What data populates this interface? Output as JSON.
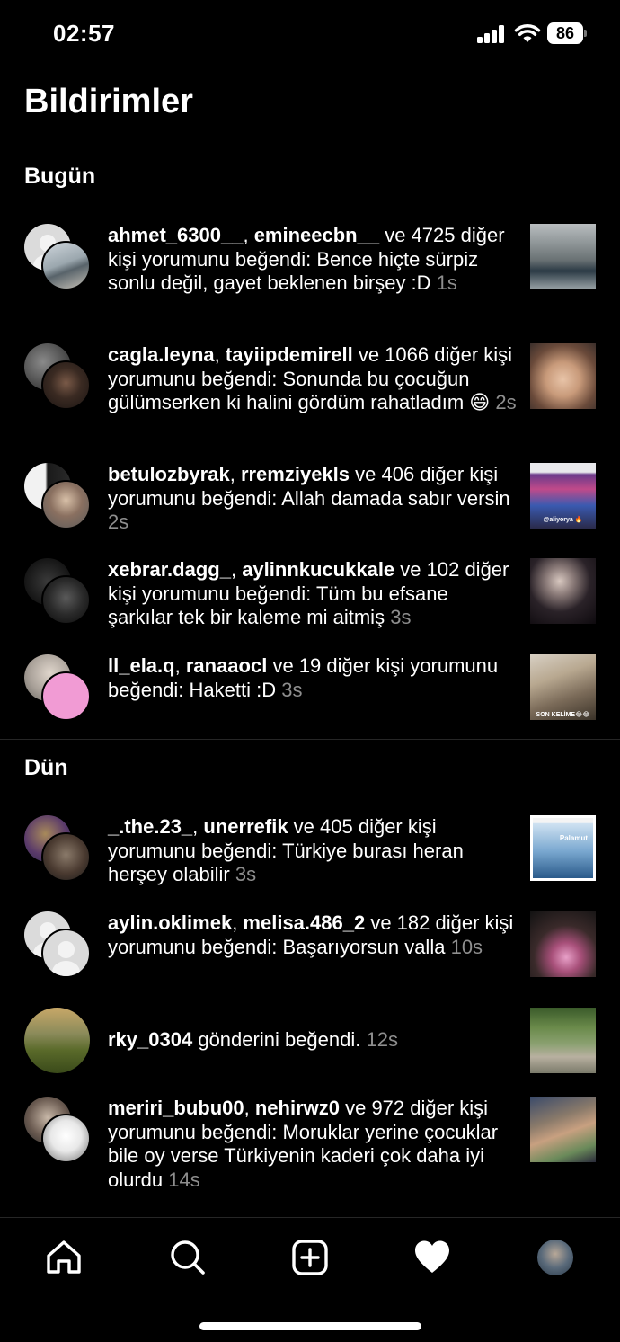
{
  "status_bar": {
    "time": "02:57",
    "battery": "86"
  },
  "title": "Bildirimler",
  "sections": [
    {
      "title": "Bugün"
    },
    {
      "title": "Dün"
    }
  ],
  "notifications": [
    {
      "users": [
        "ahmet_6300__",
        "emineecbn__"
      ],
      "separator": ", ",
      "message": " ve 4725 diğer kişi yorumunu beğendi: Bence hiçte sürpiz sonlu değil, gayet beklenen birşey :D",
      "time": "1s"
    },
    {
      "users": [
        "cagla.leyna",
        "tayiipdemirell"
      ],
      "separator": ", ",
      "message": " ve 1066 diğer kişi yorumunu beğendi: Sonunda bu çocuğun gülümserken ki halini gördüm rahatladım 😄",
      "time": "2s"
    },
    {
      "users": [
        "betulozbyrak",
        "rremziyekls"
      ],
      "separator": ", ",
      "message": " ve 406 diğer kişi yorumunu beğendi: Allah damada sabır versin",
      "time": "2s",
      "thumb_caption": "@aliyorya 🔥"
    },
    {
      "users": [
        "xebrar.dagg_",
        "aylinnkucukkale"
      ],
      "separator": ", ",
      "message": " ve 102 diğer kişi yorumunu beğendi: Tüm bu efsane şarkılar tek bir kaleme mi aitmiş",
      "time": "3s"
    },
    {
      "users": [
        "ll_ela.q",
        "ranaaocl"
      ],
      "separator": ", ",
      "message": " ve 19 diğer kişi yorumunu beğendi: Haketti :D",
      "time": "3s",
      "thumb_caption": "SON KELİME😂😂"
    },
    {
      "users": [
        "_.the.23_",
        "unerrefik"
      ],
      "separator": ", ",
      "message": " ve 405 diğer kişi yorumunu beğendi: Türkiye burası heran herşey olabilir",
      "time": "3s",
      "thumb_caption": "Palamut"
    },
    {
      "users": [
        "aylin.oklimek",
        "melisa.486_2"
      ],
      "separator": ", ",
      "message": " ve 182 diğer kişi yorumunu beğendi: Başarıyorsun valla",
      "time": "10s"
    },
    {
      "users": [
        "rky_0304"
      ],
      "separator": "",
      "message": " gönderini beğendi.",
      "time": "12s"
    },
    {
      "users": [
        "meriri_bubu00",
        "nehirwz0"
      ],
      "separator": ", ",
      "message": " ve 972 diğer kişi yorumunu beğendi: Moruklar yerine çocuklar bile oy verse Türkiyenin kaderi çok daha iyi olurdu",
      "time": "14s"
    }
  ],
  "tabs": [
    {
      "name": "home-icon"
    },
    {
      "name": "search-icon"
    },
    {
      "name": "create-icon"
    },
    {
      "name": "heart-icon"
    },
    {
      "name": "profile-avatar"
    }
  ],
  "colors": {
    "background": "#000000",
    "text": "#ffffff",
    "secondary_text": "#8e8e8e",
    "divider": "#262626"
  }
}
